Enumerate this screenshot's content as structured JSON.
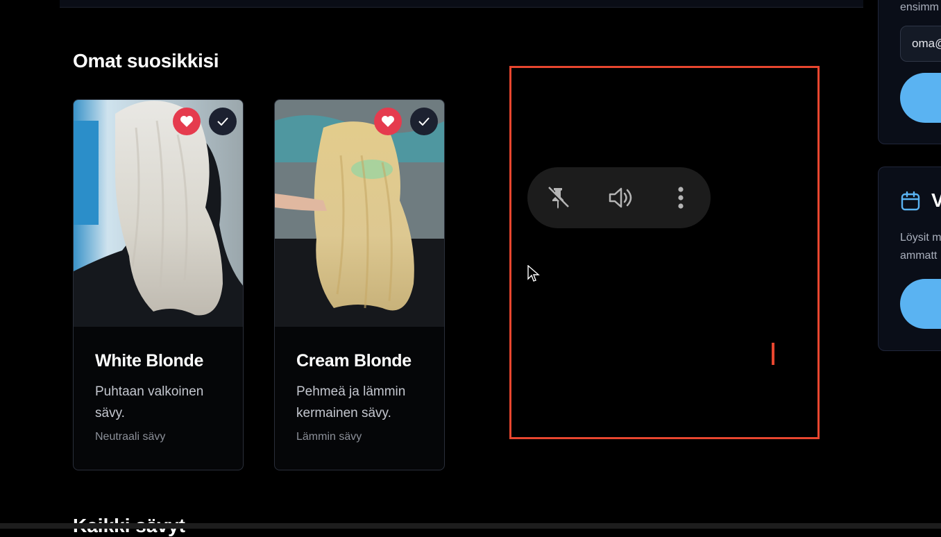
{
  "section": {
    "title": "Omat suosikkisi"
  },
  "cards": [
    {
      "name": "White Blonde",
      "description": "Puhtaan valkoinen sävy.",
      "tone": "Neutraali sävy"
    },
    {
      "name": "Cream Blonde",
      "description": "Pehmeä ja lämmin kermainen sävy.",
      "tone": "Lämmin sävy"
    }
  ],
  "video_controls": {
    "icons": [
      "pin-off-icon",
      "volume-icon",
      "more-vertical-icon"
    ]
  },
  "sidebar": {
    "card1": {
      "text_partial": "ensimm",
      "email_value": "oma@"
    },
    "card2": {
      "heading_partial": "V",
      "line1": "Löysit m",
      "line2": "ammatt"
    }
  },
  "next_section": {
    "title_partial": "Kaikki sävyt"
  },
  "colors": {
    "favorite": "#e53b4e",
    "check": "#1c2130",
    "accent_blue": "#5ab3f2",
    "panel_border": "#e8462f"
  }
}
